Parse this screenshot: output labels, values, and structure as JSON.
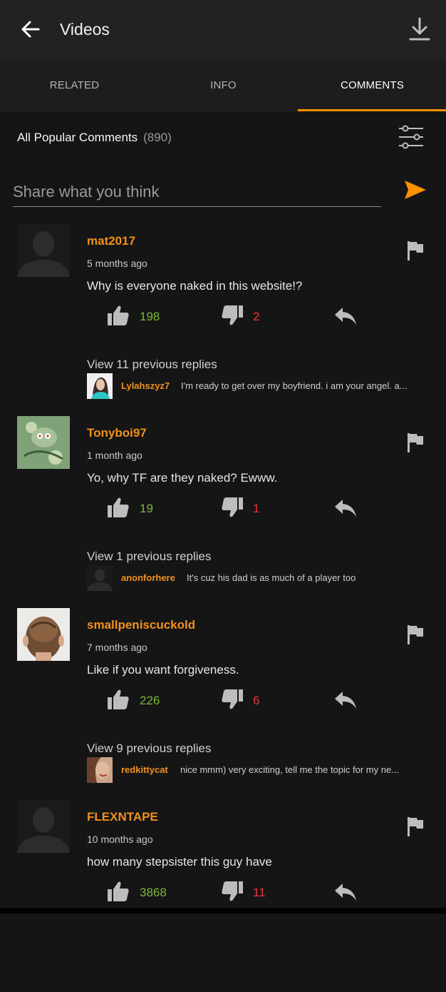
{
  "header": {
    "title": "Videos",
    "back_icon": "arrow-left-icon",
    "download_icon": "download-icon"
  },
  "tabs": [
    {
      "label": "RELATED",
      "active": false
    },
    {
      "label": "INFO",
      "active": false
    },
    {
      "label": "COMMENTS",
      "active": true
    }
  ],
  "comments_header": {
    "label": "All Popular Comments",
    "count": "(890)",
    "filter_icon": "sliders-icon"
  },
  "share": {
    "placeholder": "Share what you think",
    "send_icon": "send-icon"
  },
  "comments": [
    {
      "username": "mat2017",
      "time": "5 months ago",
      "text": "Why is everyone naked in this website!?",
      "likes": "198",
      "dislikes": "2",
      "view_replies": "View 11 previous replies",
      "reply_user": "Lylahszyz7",
      "reply_text": "I'm ready to get over my boyfriend. i am your angel. a..."
    },
    {
      "username": "Tonyboi97",
      "time": "1 month ago",
      "text": "Yo, why TF are they naked? Ewww.",
      "likes": "19",
      "dislikes": "1",
      "view_replies": "View 1 previous replies",
      "reply_user": "anonforhere",
      "reply_text": "It's cuz his dad is as much of a player too"
    },
    {
      "username": "smallpeniscuckold",
      "time": "7 months ago",
      "text": "Like if you want forgiveness.",
      "likes": "226",
      "dislikes": "6",
      "view_replies": "View 9 previous replies",
      "reply_user": "redkittycat",
      "reply_text": "nice mmm) very exciting, tell me the topic for my ne..."
    },
    {
      "username": "FLEXNTAPE",
      "time": "10 months ago",
      "text": "how many stepsister this guy have",
      "likes": "3868",
      "dislikes": "11"
    }
  ],
  "colors": {
    "accent": "#ff9000",
    "username": "#f1911d",
    "like": "#7db83a",
    "dislike": "#e53935",
    "background": "#151515"
  }
}
